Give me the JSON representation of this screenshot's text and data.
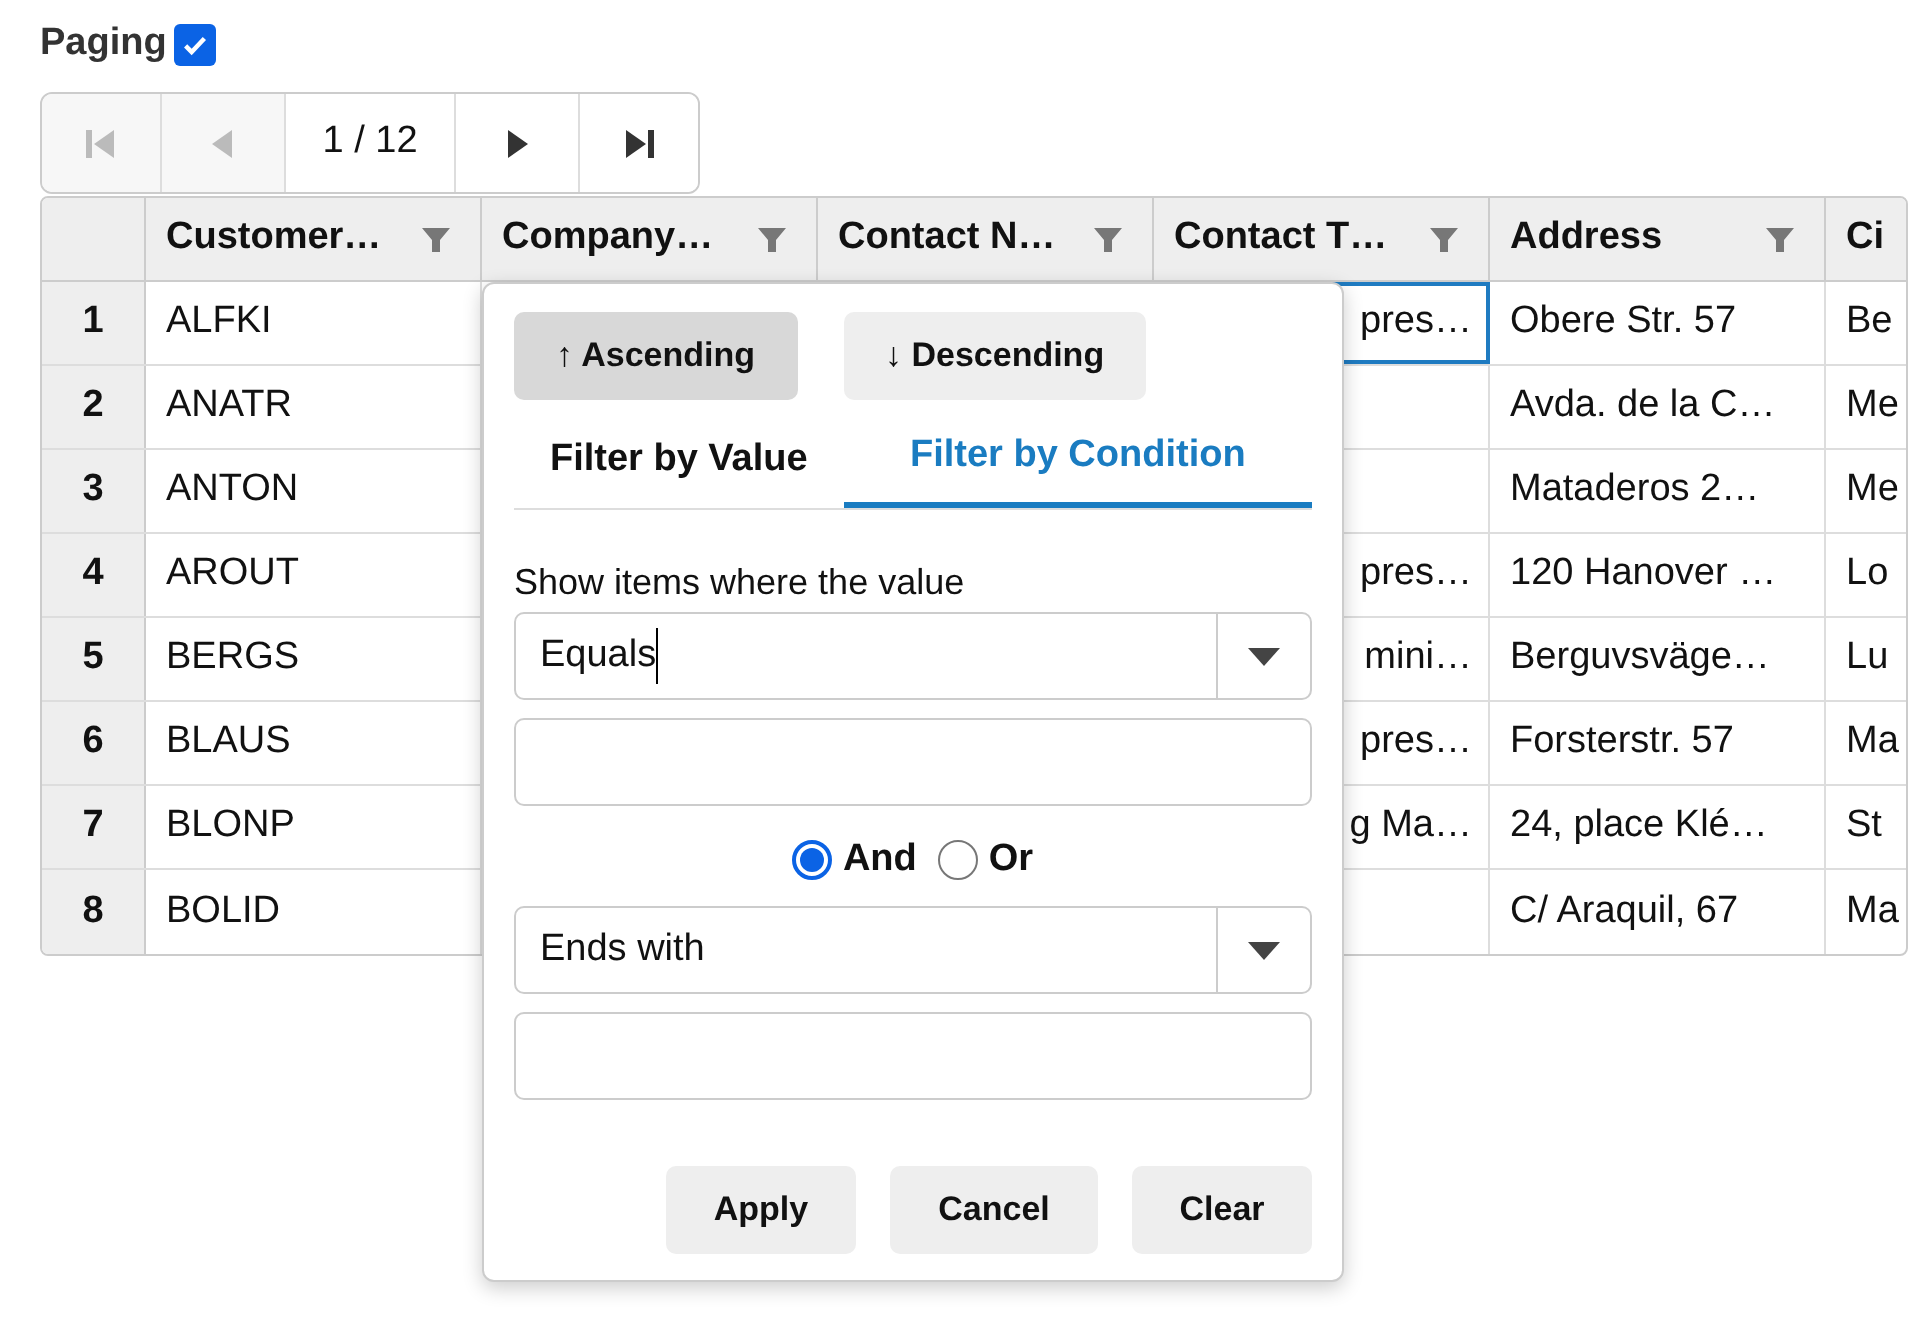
{
  "paging": {
    "label": "Paging",
    "checked": true
  },
  "pager": {
    "buttons": [
      {
        "kind": "first",
        "disabled": true
      },
      {
        "kind": "prev",
        "disabled": true
      },
      {
        "kind": "next",
        "disabled": false
      },
      {
        "kind": "last",
        "disabled": false
      }
    ],
    "page_text": "1 / 12"
  },
  "grid": {
    "columns": [
      {
        "label": "Customer…",
        "filter": true
      },
      {
        "label": "Company…",
        "filter": true
      },
      {
        "label": "Contact N…",
        "filter": true
      },
      {
        "label": "Contact T…",
        "filter": true
      },
      {
        "label": "Address",
        "filter": true
      },
      {
        "label": "Ci"
      }
    ],
    "rows": [
      {
        "number": "1",
        "cells": [
          {
            "text": "ALFKI",
            "selected": false
          },
          null,
          null,
          {
            "text": "pres…",
            "selected": true
          },
          {
            "text": "Obere Str. 57",
            "selected": false
          },
          {
            "text": "Be",
            "selected": false
          }
        ]
      },
      {
        "number": "2",
        "cells": [
          {
            "text": "ANATR",
            "selected": false
          },
          null,
          null,
          null,
          {
            "text": "Avda. de la C…",
            "selected": false
          },
          {
            "text": "Me",
            "selected": false
          }
        ]
      },
      {
        "number": "3",
        "cells": [
          {
            "text": "ANTON",
            "selected": false
          },
          null,
          null,
          null,
          {
            "text": "Mataderos 2…",
            "selected": false
          },
          {
            "text": "Me",
            "selected": false
          }
        ]
      },
      {
        "number": "4",
        "cells": [
          {
            "text": "AROUT",
            "selected": false
          },
          null,
          null,
          {
            "text": "pres…",
            "selected": false
          },
          {
            "text": "120 Hanover …",
            "selected": false
          },
          {
            "text": "Lo",
            "selected": false
          }
        ]
      },
      {
        "number": "5",
        "cells": [
          {
            "text": "BERGS",
            "selected": false
          },
          null,
          null,
          {
            "text": "mini…",
            "selected": false
          },
          {
            "text": "Berguvsväge…",
            "selected": false
          },
          {
            "text": "Lu",
            "selected": false
          }
        ]
      },
      {
        "number": "6",
        "cells": [
          {
            "text": "BLAUS",
            "selected": false
          },
          null,
          null,
          {
            "text": "pres…",
            "selected": false
          },
          {
            "text": "Forsterstr. 57",
            "selected": false
          },
          {
            "text": "Ma",
            "selected": false
          }
        ]
      },
      {
        "number": "7",
        "cells": [
          {
            "text": "BLONP",
            "selected": false
          },
          null,
          null,
          {
            "text": "g Ma…",
            "selected": false
          },
          {
            "text": "24, place Klé…",
            "selected": false
          },
          {
            "text": "St",
            "selected": false
          }
        ]
      },
      {
        "number": "8",
        "cells": [
          {
            "text": "BOLID",
            "selected": false
          },
          null,
          null,
          null,
          {
            "text": "C/ Araquil, 67",
            "selected": false
          },
          {
            "text": "Ma",
            "selected": false
          }
        ]
      }
    ]
  },
  "filter_popup": {
    "sort_buttons": [
      {
        "label": "↑ Ascending",
        "selected": true
      },
      {
        "label": "↓ Descending",
        "selected": false
      }
    ],
    "tabs": [
      {
        "label": "Filter by Value",
        "selected": false
      },
      {
        "label": "Filter by Condition",
        "selected": true
      }
    ],
    "prompt": "Show items where the value",
    "first_condition": {
      "value": "Equals",
      "focused": true
    },
    "operators": [
      {
        "label": "And",
        "selected": true
      },
      {
        "label": "Or",
        "selected": false
      }
    ],
    "second_condition": {
      "value": "Ends with",
      "focused": false
    },
    "actions": [
      "Apply",
      "Cancel",
      "Clear"
    ]
  }
}
